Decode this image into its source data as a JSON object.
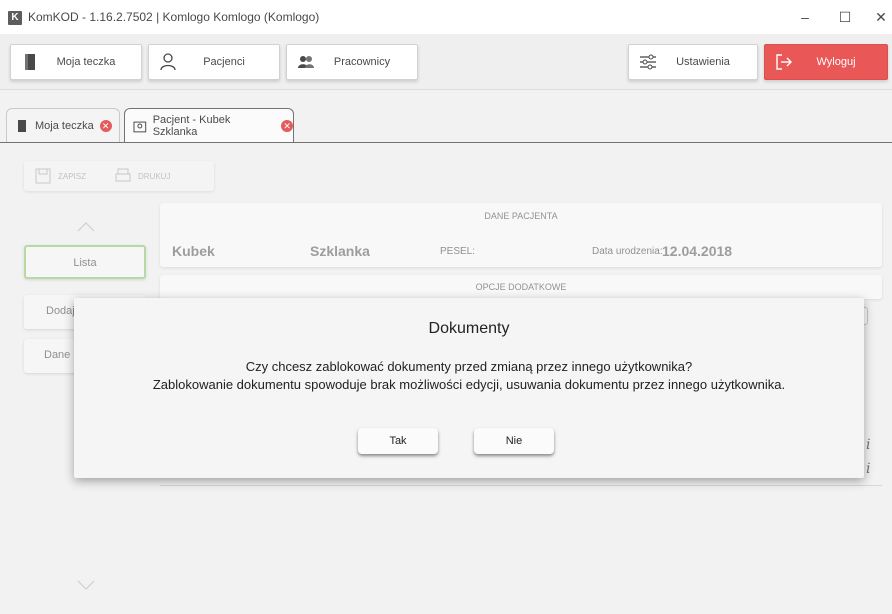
{
  "window": {
    "logo": "K",
    "title": "KomKOD - 1.16.2.7502 | Komlogo Komlogo (Komlogo)",
    "minimize": "–",
    "maximize": "☐",
    "close": "✕"
  },
  "toolbar": {
    "moja_teczka": "Moja teczka",
    "pacjenci": "Pacjenci",
    "pracownicy": "Pracownicy",
    "ustawienia": "Ustawienia",
    "wyloguj": "Wyloguj"
  },
  "tabs": [
    {
      "label": "Moja teczka"
    },
    {
      "label": "Pacjent - Kubek Szklanka"
    }
  ],
  "subtoolbar": {
    "zapisz": "ZAPISZ",
    "drukuj": "DRUKUJ"
  },
  "side": {
    "lista": "Lista",
    "dodaj": "Dodaj",
    "dane": "Dane p"
  },
  "patient": {
    "section": "DANE PACJENTA",
    "first_name": "Kubek",
    "last_name": "Szklanka",
    "pesel_label": "PESEL:",
    "dob_label": "Data urodzenia:",
    "dob_value": "12.04.2018"
  },
  "options": {
    "section": "OPCJE DODATKOWE",
    "select_fragment": "ie",
    "col_fragment": "ja"
  },
  "dialog": {
    "title": "Dokumenty",
    "line1": "Czy chcesz zablokować dokumenty przed zmianą przez innego użytkownika?",
    "line2": "Zablokowanie dokumentu spowoduje brak możliwości edycji, usuwania dokumentu przez innego użytkownika.",
    "yes": "Tak",
    "no": "Nie"
  },
  "colors": {
    "logout_bg": "#e43232",
    "selected_border": "#a9d18e",
    "close_badge": "#e03636"
  }
}
